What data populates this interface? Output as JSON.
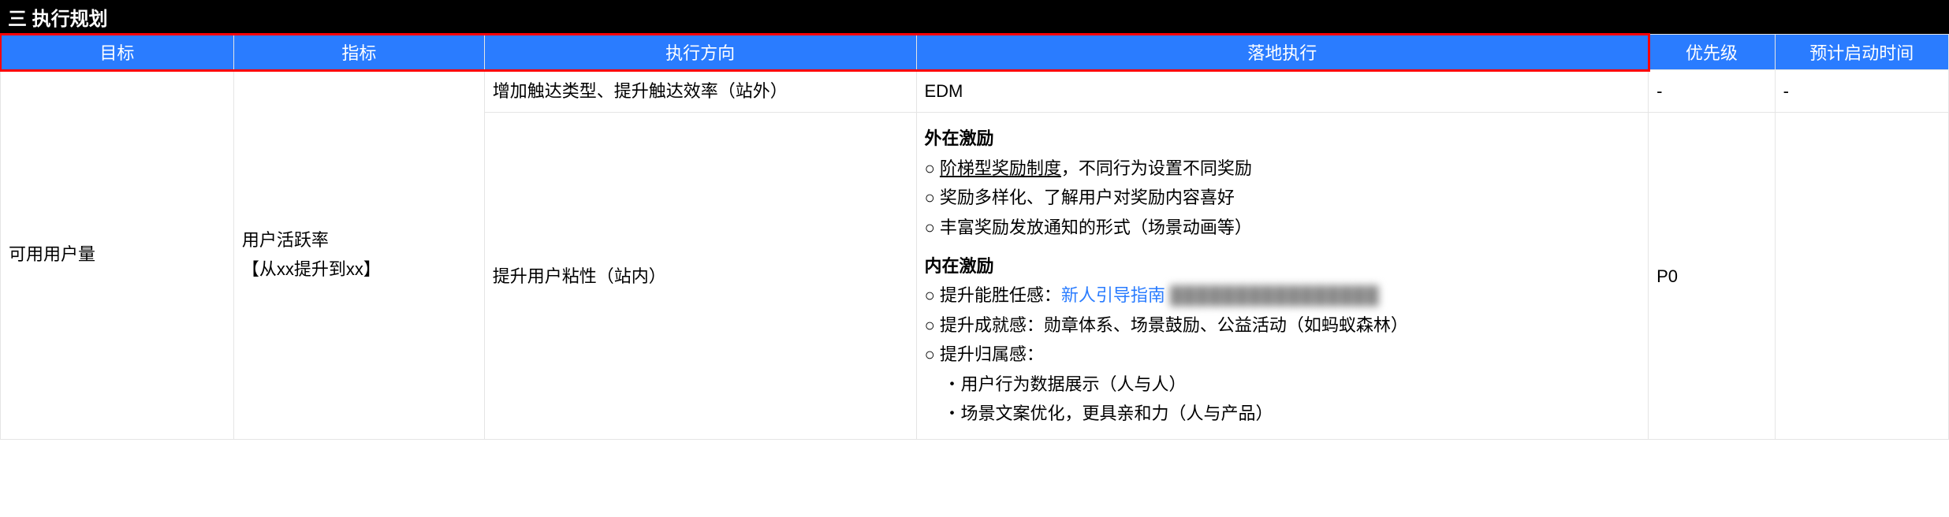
{
  "section_title": "三 执行规划",
  "columns": {
    "c0": "目标",
    "c1": "指标",
    "c2": "执行方向",
    "c3": "落地执行",
    "c4": "优先级",
    "c5": "预计启动时间"
  },
  "col_widths": {
    "c0": 188,
    "c1": 202,
    "c2": 348,
    "c3": 590,
    "c4": 102,
    "c5": 140
  },
  "rows": {
    "r1": {
      "goal": "可用用户量",
      "metric_l1": "用户活跃率",
      "metric_l2": "【从xx提升到xx】",
      "direction_top": "增加触达类型、提升触达效率（站外）",
      "landing_top": "EDM",
      "priority_top": "-",
      "eta_top": "-",
      "direction_main": "提升用户粘性（站内）",
      "ext_title": "外在激励",
      "ext_b1_underline": "阶梯型奖励制度",
      "ext_b1_rest": "，不同行为设置不同奖励",
      "ext_b2": "奖励多样化、了解用户对奖励内容喜好",
      "ext_b3": "丰富奖励发放通知的形式（场景动画等）",
      "int_title": "内在激励",
      "int_b1_pre": "提升能胜任感：",
      "int_b1_link": "新人引导指南",
      "int_b1_blur": "████████████████",
      "int_b2": "提升成就感：勋章体系、场景鼓励、公益活动（如蚂蚁森林）",
      "int_b3": "提升归属感：",
      "int_b3_sub1": "用户行为数据展示（人与人）",
      "int_b3_sub2": "场景文案优化，更具亲和力（人与产品）",
      "priority_main": "P0",
      "eta_main": ""
    }
  }
}
